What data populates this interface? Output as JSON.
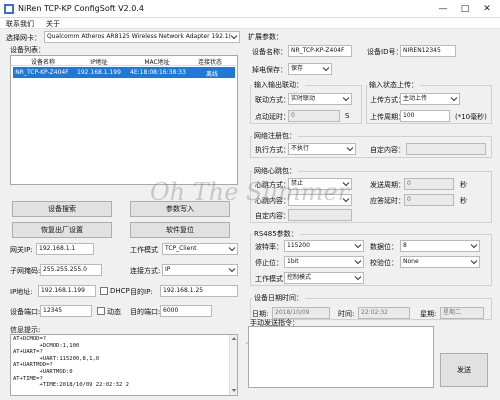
{
  "window": {
    "title": "NiRen TCP-KP ConfigSoft V2.0.4",
    "controls": {
      "minimize": "—",
      "maximize": "□",
      "close": "✕"
    }
  },
  "menu": {
    "items": [
      "联系我们",
      "关于"
    ]
  },
  "left": {
    "nic_label": "选择网卡：",
    "nic_value": "Qualcomm Atheros AR8125 Wireless Network Adapter 192.1(",
    "device_list_label": "设备列表：",
    "table": {
      "columns": [
        "设备名称",
        "IP地址",
        "MAC地址",
        "连接状态"
      ],
      "rows": [
        [
          "NR_TCP-KP-Z404F",
          "192.168.1.199",
          "4E:18:08:16:38:33",
          "离线"
        ]
      ]
    },
    "buttons": {
      "search": "设备搜索",
      "apply": "参数写入",
      "factory_reset": "恢复出厂设置",
      "software_reset": "软件复位"
    },
    "gateway_label": "网关IP:",
    "gateway_value": "192.168.1.1",
    "work_mode_label": "工作模式",
    "work_mode_value": "TCP_Client",
    "subnet_label": "子网掩码:",
    "subnet_value": "255.255.255.0",
    "conn_mode_label": "连接方式:",
    "conn_mode_value": "IP",
    "ip_label": "IP地址:",
    "ip_value": "192.168.1.199",
    "dhcp_label": "DHCP",
    "dest_ip_label": "目的IP:",
    "dest_ip_value": "192.168.1.25",
    "port_label": "设备端口:",
    "port_value": "12345",
    "dynamic_label": "动态",
    "dest_port_label": "目的端口:",
    "dest_port_value": "6000",
    "log_label": "信息提示:",
    "log_lines": [
      "AT+DCMOD=?",
      "        +DCMOD:1,100",
      "AT+UART=?",
      "        +UART:115200,8,1,0",
      "AT+UARTMOD=?",
      "        +UARTMOD:0",
      "AT+TIME=?",
      "        +TIME:2018/10/09 22:02:32 2"
    ]
  },
  "right": {
    "ext_params_label": "扩展参数：",
    "device_name_label": "设备名称：",
    "device_name_value": "NR_TCP-KP-Z404F",
    "device_id_label": "设备ID号：",
    "device_id_value": "NIREN12345",
    "power_loss_label": "掉电保存：",
    "power_loss_value": "保存",
    "io_link_label": "输入输出联动：",
    "link_mode_label": "联动方式：",
    "link_mode_value": "实时联动",
    "upload_label": "输入状态上传：",
    "upload_mode_label": "上传方式：",
    "upload_mode_value": "主动上传",
    "jog_time_label": "点动延时：",
    "jog_time_value": "0",
    "jog_time_unit": "S",
    "upload_period_label": "上传周期：",
    "upload_period_value": "100",
    "upload_period_unit": "(*10毫秒)",
    "register_label": "网络注册包：",
    "exec_mode_label": "执行方式：",
    "exec_mode_value": "不执行",
    "custom_content_label": "自定内容：",
    "heartbeat_label": "网络心跳包：",
    "hb_mode_label": "心跳方式：",
    "hb_mode_value": "禁止",
    "send_period_label": "发送周期：",
    "send_period_value": "0",
    "send_period_unit": "秒",
    "hb_content_label": "心跳内容：",
    "reply_timeout_label": "应答延时：",
    "reply_timeout_value": "0",
    "reply_timeout_unit": "秒",
    "hb_custom_label": "自定内容：",
    "rs485_label": "RS485参数：",
    "baud_label": "波特率：",
    "baud_value": "115200",
    "data_bits_label": "数据位：",
    "data_bits_value": "8",
    "stop_bits_label": "停止位：",
    "stop_bits_value": "1bit",
    "parity_label": "校验位：",
    "parity_value": "None",
    "rs485_mode_label": "工作模式：",
    "rs485_mode_value": "控制模式",
    "datetime_label": "设备日期时间：",
    "date_label": "日期:",
    "date_value": "2018/10/09",
    "time_label": "时间:",
    "time_value": "22:02:32",
    "weekday_label": "星期:",
    "weekday_value": "星期二",
    "manual_send_label": "手动发送指令：",
    "send_button": "发送"
  },
  "watermark": "Oh The Summer"
}
